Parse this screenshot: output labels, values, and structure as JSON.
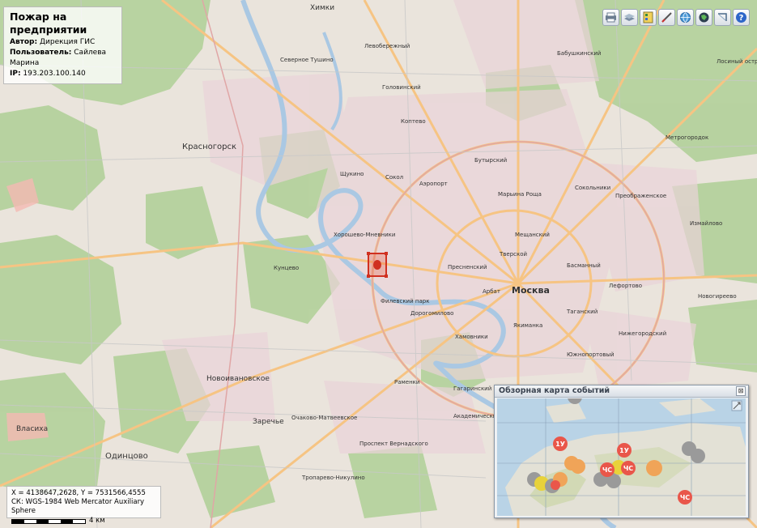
{
  "info": {
    "title": "Пожар на предприятии",
    "author_label": "Автор:",
    "author": "Дирекция ГИС",
    "user_label": "Пользователь:",
    "user": "Сайлева Марина",
    "ip_label": "IP:",
    "ip": "193.203.100.140"
  },
  "toolbar": {
    "icons": [
      "printer-icon",
      "layers-icon",
      "legend-icon",
      "measure-icon",
      "globe-icon",
      "basemap-icon",
      "window-icon",
      "help-icon"
    ]
  },
  "coords": {
    "xy": "X = 4138647,2628, Y = 7531566,4555",
    "crs": "СК: WGS-1984 Web Mercator Auxiliary Sphere",
    "scale_label": "4 км"
  },
  "overview": {
    "title": "Обзорная карта событий",
    "close": "⊠",
    "markers": [
      {
        "label": "1У",
        "color": "#e9564a"
      },
      {
        "label": "1У",
        "color": "#e9564a"
      },
      {
        "label": "ЧС",
        "color": "#e9564a"
      },
      {
        "label": "ЧС",
        "color": "#e9564a"
      },
      {
        "label": "ЧС",
        "color": "#e9564a"
      }
    ]
  },
  "map_labels": {
    "moscow": "Москва",
    "khimki": "Химки",
    "krasnogorsk": "Красногорск",
    "odintsovo": "Одинцово",
    "novoivanovskoe": "Новоивановское",
    "zarechye": "Заречье",
    "vlasikha": "Власиха",
    "tushino": "Северное Тушино",
    "sokol": "Сокол",
    "aeroport": "Аэропорт",
    "marina": "Марьина Роща",
    "sokolniki": "Сокольники",
    "lefortovo": "Лефортово",
    "tagansky": "Таганский",
    "arbat": "Арбат",
    "khamovniki": "Хамовники",
    "ramenki": "Раменки",
    "ochakovo": "Очаково-Матвеевское",
    "babushkinsky": "Бабушкинский",
    "preobrazhenskoe": "Преображенское",
    "izmaylovo": "Измайлово",
    "yuzhnoportovy": "Южнопортовый",
    "akademichesky": "Академический",
    "gagarinsky": "Гагаринский",
    "filevsky": "Филевский парк",
    "dorogomilovo": "Дорогомилово",
    "presnensky": "Пресненский",
    "shchukino": "Щукино",
    "khoroshevo": "Хорошево-Мневники",
    "kuntsevo": "Кунцево",
    "troparevo": "Тропарево-Никулино",
    "prospekt": "Проспект Вернадского",
    "butyrsky": "Бутырский",
    "tverskoy": "Тверской",
    "meshchansky": "Мещанский",
    "koptevo": "Коптево",
    "levoberezhny": "Левобережный",
    "golovinsky": "Головинский",
    "nizhegorodsky": "Нижегородский",
    "basmanny": "Басманный",
    "yakimanka": "Якиманка",
    "novogireevo": "Новогиреево",
    "metrogorodok": "Метрогородок",
    "losiny": "Лосиный остров"
  }
}
